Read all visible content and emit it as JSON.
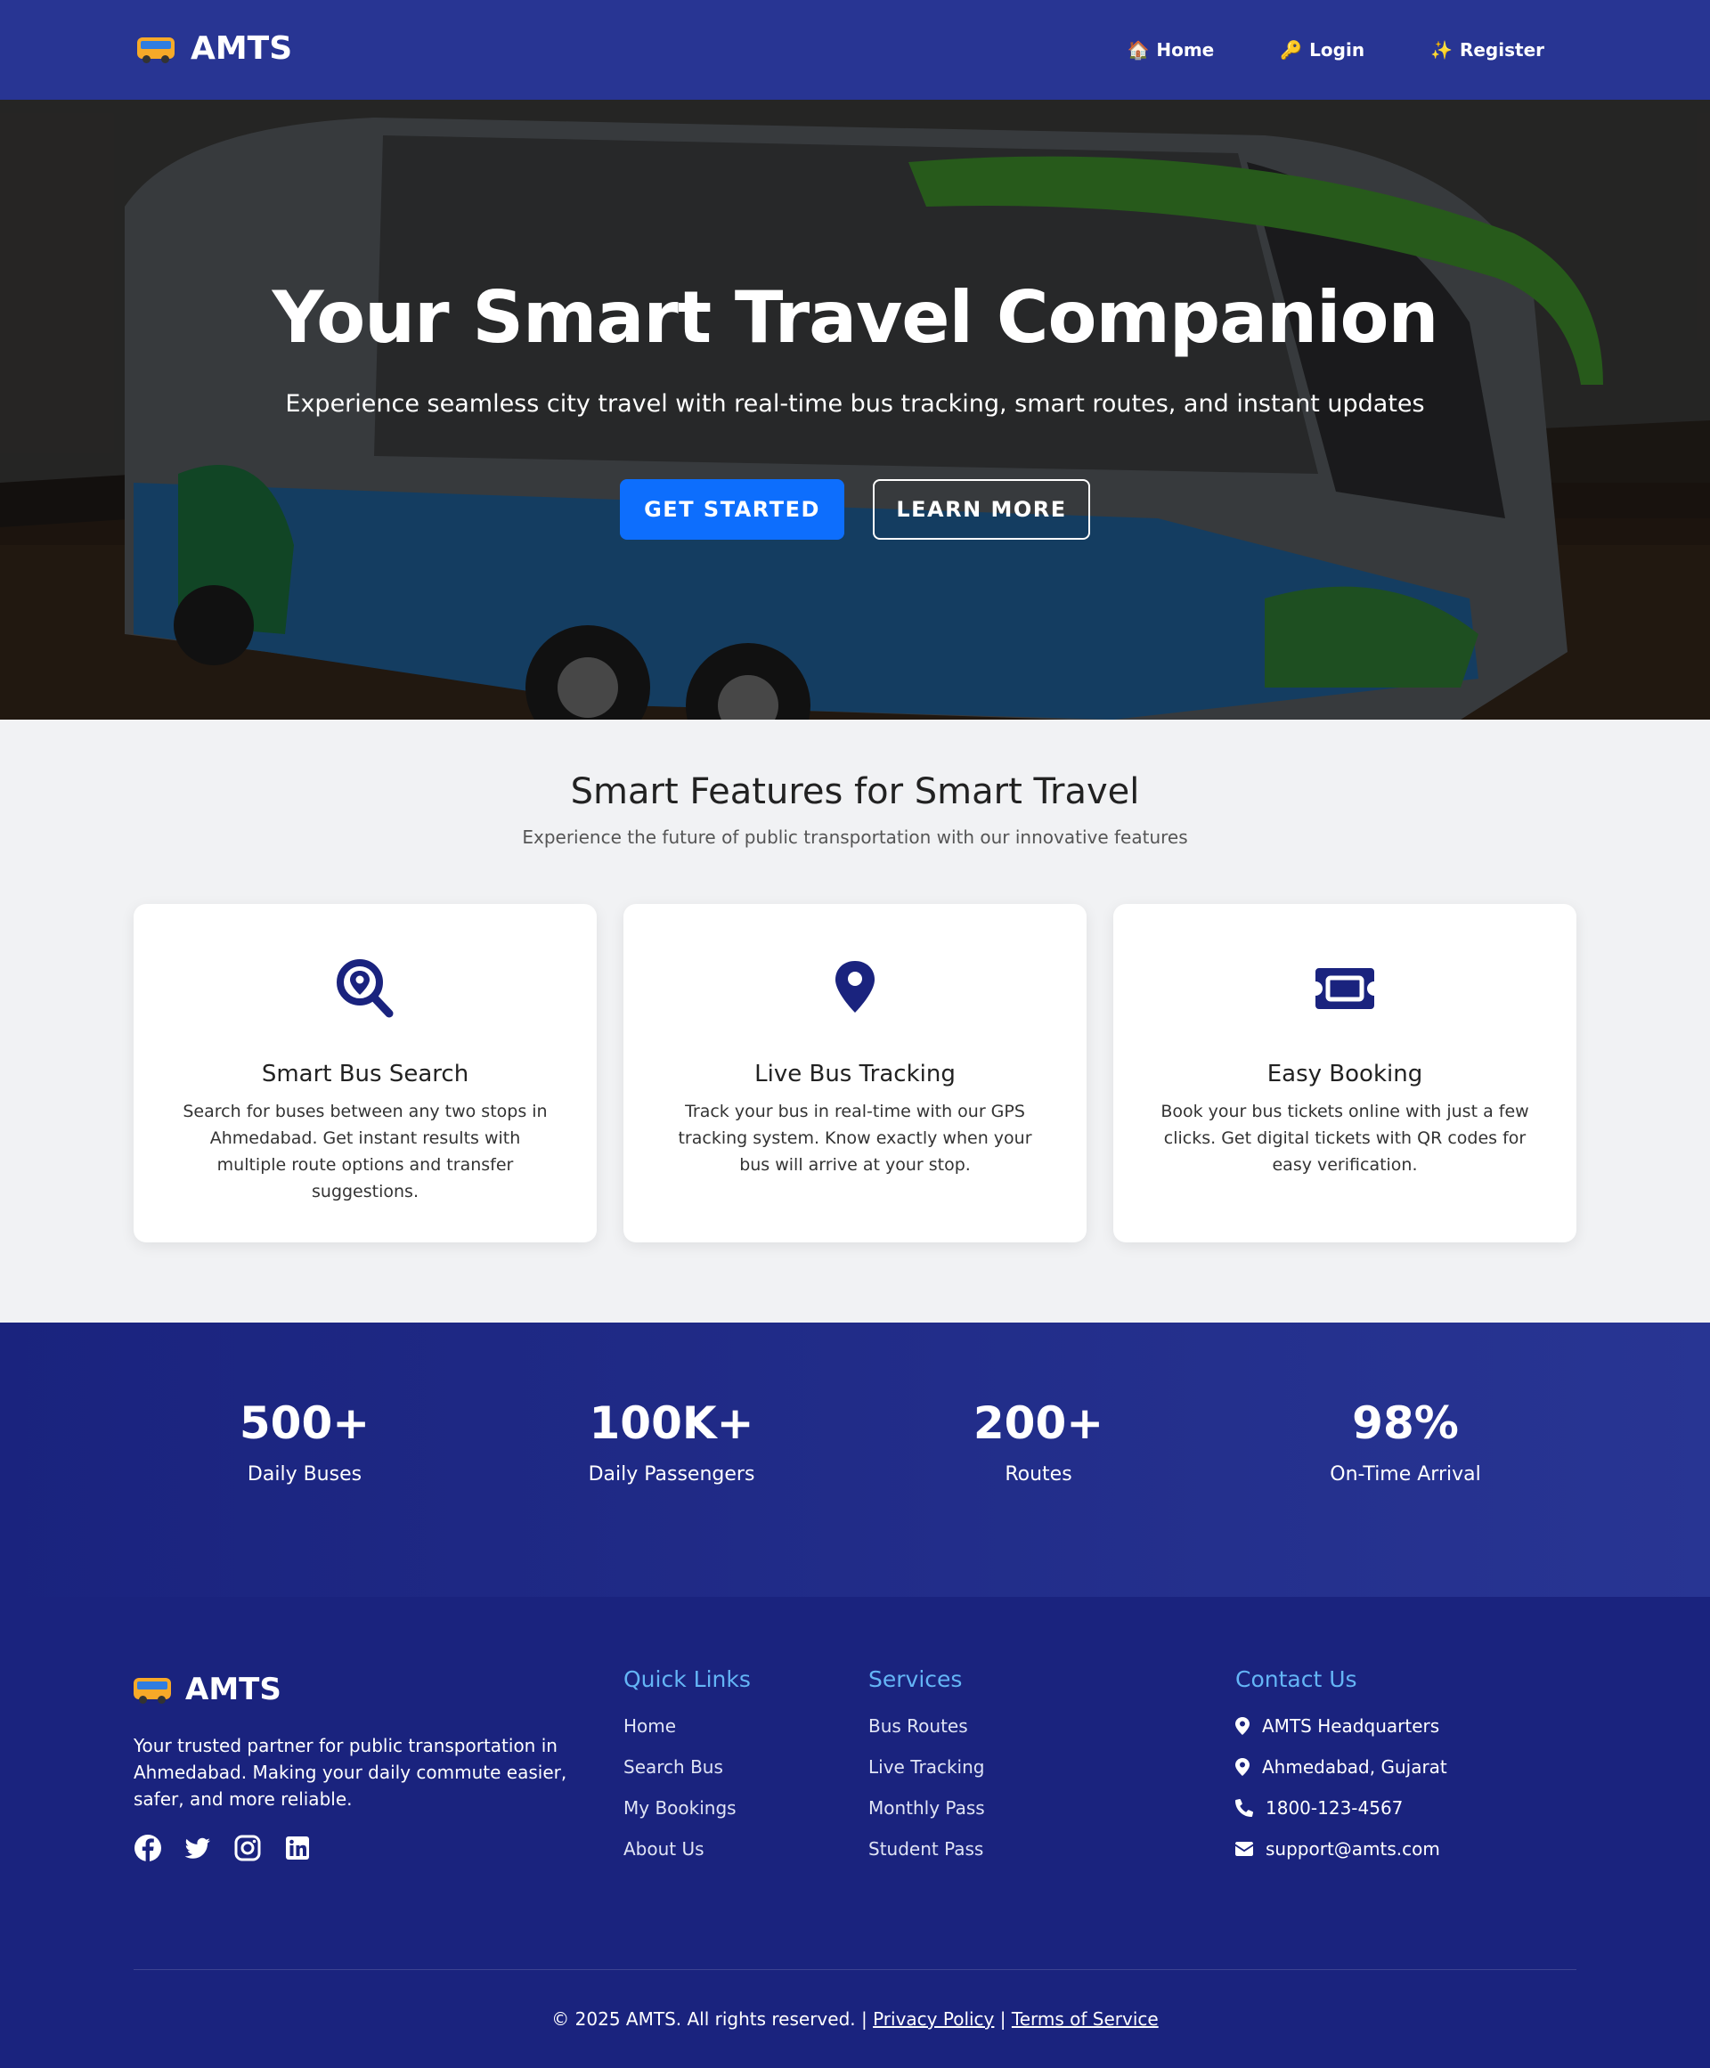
{
  "nav": {
    "brand": "AMTS",
    "links": [
      {
        "icon": "🏠",
        "label": "Home"
      },
      {
        "icon": "🔑",
        "label": "Login"
      },
      {
        "icon": "✨",
        "label": "Register"
      }
    ]
  },
  "hero": {
    "title": "Your Smart Travel Companion",
    "subtitle": "Experience seamless city travel with real-time bus tracking, smart routes, and instant updates",
    "primary_button": "GET STARTED",
    "secondary_button": "LEARN MORE"
  },
  "features": {
    "title": "Smart Features for Smart Travel",
    "subtitle": "Experience the future of public transportation with our innovative features",
    "cards": [
      {
        "icon": "search-location-icon",
        "title": "Smart Bus Search",
        "text": "Search for buses between any two stops in Ahmedabad. Get instant results with multiple route options and transfer suggestions."
      },
      {
        "icon": "map-marker-icon",
        "title": "Live Bus Tracking",
        "text": "Track your bus in real-time with our GPS tracking system. Know exactly when your bus will arrive at your stop."
      },
      {
        "icon": "ticket-icon",
        "title": "Easy Booking",
        "text": "Book your bus tickets online with just a few clicks. Get digital tickets with QR codes for easy verification."
      }
    ]
  },
  "stats": [
    {
      "value": "500+",
      "label": "Daily Buses"
    },
    {
      "value": "100K+",
      "label": "Daily Passengers"
    },
    {
      "value": "200+",
      "label": "Routes"
    },
    {
      "value": "98%",
      "label": "On-Time Arrival"
    }
  ],
  "footer": {
    "brand": "AMTS",
    "description": "Your trusted partner for public transportation in Ahmedabad. Making your daily commute easier, safer, and more reliable.",
    "quick_links": {
      "title": "Quick Links",
      "items": [
        "Home",
        "Search Bus",
        "My Bookings",
        "About Us"
      ]
    },
    "services": {
      "title": "Services",
      "items": [
        "Bus Routes",
        "Live Tracking",
        "Monthly Pass",
        "Student Pass"
      ]
    },
    "contact": {
      "title": "Contact Us",
      "address1": "AMTS Headquarters",
      "address2": "Ahmedabad, Gujarat",
      "phone": "1800-123-4567",
      "email": "support@amts.com"
    },
    "copyright": "© 2025 AMTS. All rights reserved. |",
    "privacy": "Privacy Policy",
    "separator": "|",
    "terms": "Terms of Service"
  },
  "colors": {
    "nav_bg": "#283593",
    "footer_bg": "#1a237e",
    "accent_blue": "#0d6efd",
    "icon_navy": "#1a237e",
    "footer_heading": "#64b5f6"
  }
}
